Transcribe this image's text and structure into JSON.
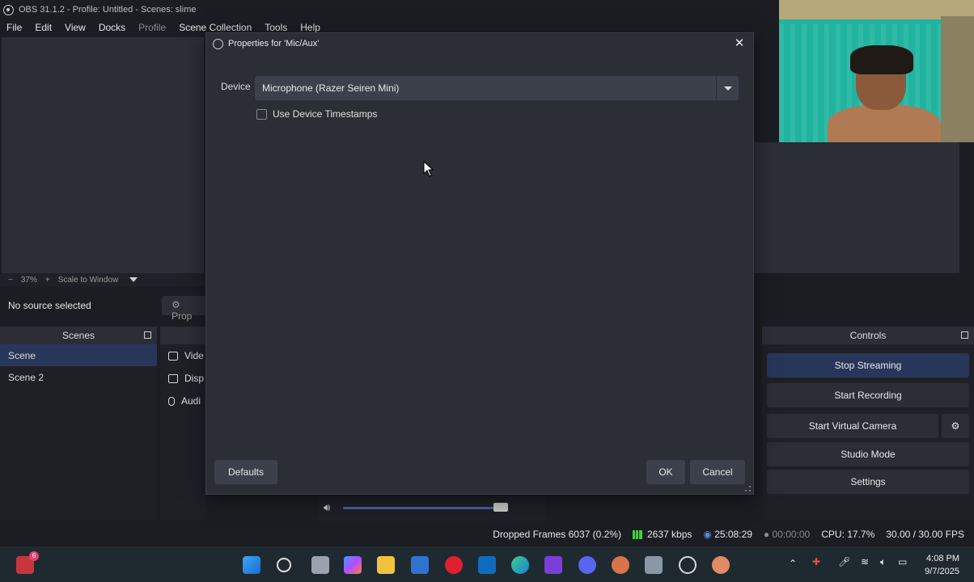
{
  "window": {
    "title": "OBS 31.1.2 - Profile: Untitled - Scenes: slime"
  },
  "menu": [
    "File",
    "Edit",
    "View",
    "Docks",
    "Profile",
    "Scene Collection",
    "Tools",
    "Help"
  ],
  "preview": {
    "zoom": "37%",
    "scale_mode": "Scale to Window",
    "minus": "−",
    "plus": "+"
  },
  "source_bar": {
    "no_source": "No source selected",
    "properties_label": "Prop"
  },
  "scenes": {
    "header": "Scenes",
    "items": [
      "Scene",
      "Scene 2"
    ],
    "active_index": 0
  },
  "sources": {
    "items": [
      "Vide",
      "Disp",
      "Audi"
    ]
  },
  "controls": {
    "header": "Controls",
    "stop_streaming": "Stop Streaming",
    "start_recording": "Start Recording",
    "start_virtual_camera": "Start Virtual Camera",
    "studio_mode": "Studio Mode",
    "settings": "Settings"
  },
  "status": {
    "dropped_frames": "Dropped Frames 6037 (0.2%)",
    "bitrate": "2637 kbps",
    "stream_time": "25:08:29",
    "rec_time": "00:00:00",
    "cpu": "CPU: 17.7%",
    "fps": "30.00 / 30.00 FPS"
  },
  "dialog": {
    "title": "Properties for 'Mic/Aux'",
    "device_label": "Device",
    "device_value": "Microphone (Razer Seiren Mini)",
    "timestamps_label": "Use Device Timestamps",
    "timestamps_checked": false,
    "defaults_button": "Defaults",
    "ok_button": "OK",
    "cancel_button": "Cancel"
  },
  "taskbar": {
    "time": "4:08 PM",
    "date": "9/7/2025",
    "badge": "6"
  },
  "colors": {
    "accent_active": "#28365a",
    "panel": "#2b2e35",
    "background": "#1b1d22",
    "signal_green": "#3ad43a"
  }
}
